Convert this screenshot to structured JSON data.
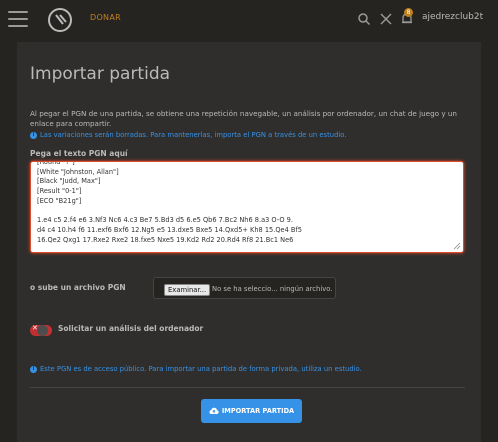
{
  "header": {
    "donate_label": "DONAR",
    "username": "ajedrezclub2t",
    "notification_count": "8"
  },
  "page": {
    "title": "Importar partida",
    "intro": "Al pegar el PGN de una partida, se obtiene una repetición navegable, un análisis por ordenador, un chat de juego y un enlace para compartir.",
    "variations_note": "Las variaciones serán borradas. Para mantenerlas, importa el PGN a través de un estudio.",
    "pgn_label": "Pega el texto PGN aquí",
    "pgn_lines": [
      "[Round \"?\"]",
      "[White \"Johnston, Allan\"]",
      "[Black \"Judd, Max\"]",
      "[Result \"0-1\"]",
      "[ECO \"B21g\"]",
      "",
      "1.e4 c5 2.f4 e6 3.Nf3 Nc6 4.c3 Be7 5.Bd3 d5 6.e5 Qb6 7.Bc2 Nh6 8.a3 O-O 9.",
      "d4 c4 10.h4 f6 11.exf6 Bxf6 12.Ng5 e5 13.dxe5 Bxe5 14.Qxd5+ Kh8 15.Qe4 Bf5",
      "16.Qe2 Qxg1 17.Rxe2 Rxe2 18.fxe5 Nxe5 19.Kd2 Rd2 20.Rd4 Rf8 21.Bc1 Ne6"
    ],
    "upload_label": "o sube un archivo PGN",
    "file_button_label": "Examinar...",
    "file_status": "No se ha selecciо... ningún archivo.",
    "analysis_toggle_label": "Solicitar un análisis del ordenador",
    "analysis_toggle_on": false,
    "public_note": "Este PGN es de acceso público. Para importar una partida de forma privada, utiliza un estudio.",
    "import_button_label": "IMPORTAR PARTIDA"
  },
  "colors": {
    "background": "#262421",
    "panel": "#302e2c",
    "accent": "#3692e7",
    "donate": "#bf811d",
    "error_border": "#dd4a2c",
    "toggle_off": "#c33031"
  },
  "icons": [
    "menu-icon",
    "logo-icon",
    "search-icon",
    "crossed-swords-icon",
    "bell-icon",
    "info-icon",
    "cloud-upload-icon",
    "resize-grip-icon"
  ]
}
